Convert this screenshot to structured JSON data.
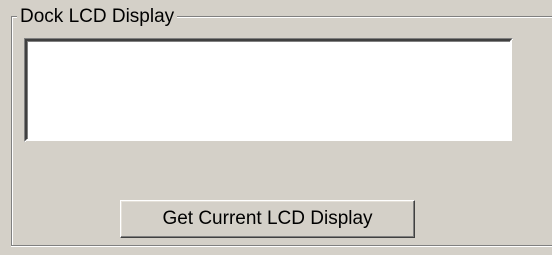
{
  "dock_lcd_group": {
    "title": "Dock LCD Display",
    "lcd_text": ""
  },
  "get_lcd_button": {
    "label": "Get Current LCD Display"
  }
}
